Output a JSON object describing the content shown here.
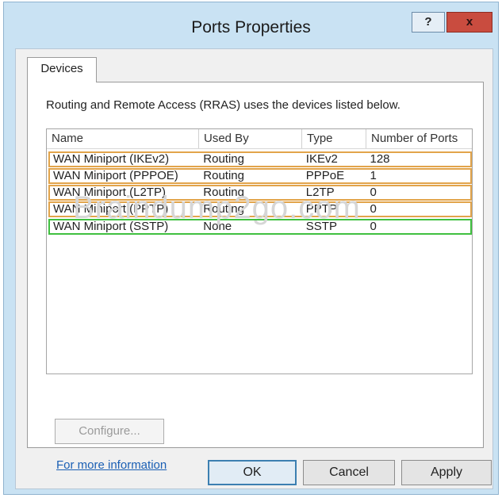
{
  "window": {
    "title": "Ports Properties",
    "help_label": "?",
    "close_label": "x"
  },
  "tabs": [
    {
      "label": "Devices",
      "active": true
    }
  ],
  "devices_tab": {
    "description": "Routing and Remote Access (RRAS) uses the devices listed below.",
    "columns": [
      "Name",
      "Used By",
      "Type",
      "Number of Ports"
    ],
    "rows": [
      {
        "name": "WAN Miniport (IKEv2)",
        "used_by": "Routing",
        "type": "IKEv2",
        "ports": "128",
        "highlight": "orange"
      },
      {
        "name": "WAN Miniport (PPPOE)",
        "used_by": "Routing",
        "type": "PPPoE",
        "ports": "1",
        "highlight": "orange"
      },
      {
        "name": "WAN Miniport (L2TP)",
        "used_by": "Routing",
        "type": "L2TP",
        "ports": "0",
        "highlight": "orange"
      },
      {
        "name": "WAN Miniport (PPTP)",
        "used_by": "Routing",
        "type": "PPTP",
        "ports": "0",
        "highlight": "orange"
      },
      {
        "name": "WAN Miniport (SSTP)",
        "used_by": "None",
        "type": "SSTP",
        "ports": "0",
        "highlight": "green"
      }
    ],
    "watermark": "Braindump2go.com",
    "configure_label": "Configure...",
    "more_info_link": "For more information"
  },
  "buttons": {
    "ok": "OK",
    "cancel": "Cancel",
    "apply": "Apply"
  },
  "colors": {
    "frame": "#c9e2f3",
    "highlight_orange": "#e2a44b",
    "highlight_green": "#40c040",
    "close_button": "#c94c3f",
    "link": "#1a5fb4"
  }
}
